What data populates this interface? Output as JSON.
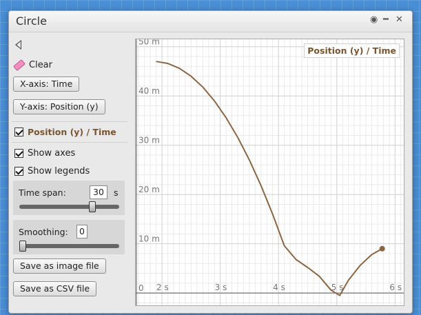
{
  "window": {
    "title": "Circle",
    "controls": [
      "◉",
      "━",
      "✕"
    ]
  },
  "sidebar": {
    "clear_label": "Clear",
    "x_axis_button": "X-axis: Time",
    "y_axis_button": "Y-axis: Position (y)",
    "series_label": "Position (y) / Time",
    "series_checked": true,
    "show_axes_label": "Show axes",
    "show_axes_checked": true,
    "show_legends_label": "Show legends",
    "show_legends_checked": true,
    "time_span_label": "Time span:",
    "time_span_value": "30",
    "time_span_unit": "s",
    "time_span_slider_fraction": 0.75,
    "smoothing_label": "Smoothing:",
    "smoothing_value": "0",
    "smoothing_slider_fraction": 0.0,
    "save_image_button": "Save as image file",
    "save_csv_button": "Save as CSV file"
  },
  "chart_data": {
    "type": "line",
    "legend": "Position (y) / Time",
    "legend_position": "top-right",
    "color": "#8b6542",
    "grid": true,
    "xlim": [
      1.55,
      6.15
    ],
    "ylim": [
      -2.5,
      51.5
    ],
    "x_ticks": [
      {
        "value": 2,
        "label": "2 s"
      },
      {
        "value": 3,
        "label": "3 s"
      },
      {
        "value": 4,
        "label": "4 s"
      },
      {
        "value": 5,
        "label": "5 s"
      },
      {
        "value": 6,
        "label": "6 s"
      }
    ],
    "y_ticks": [
      {
        "value": 0,
        "label": "0"
      },
      {
        "value": 10,
        "label": "10 m"
      },
      {
        "value": 20,
        "label": "20 m"
      },
      {
        "value": 30,
        "label": "30 m"
      },
      {
        "value": 40,
        "label": "40 m"
      },
      {
        "value": 50,
        "label": "50 m"
      }
    ],
    "series": [
      {
        "x": [
          1.9,
          2.1,
          2.3,
          2.5,
          2.7,
          2.9,
          3.1,
          3.3,
          3.5,
          3.7,
          3.9,
          4.1,
          4.3,
          4.5,
          4.7,
          4.9,
          5.05,
          5.2,
          5.4,
          5.6,
          5.78
        ],
        "y": [
          47.0,
          46.6,
          45.6,
          44.0,
          41.8,
          39.0,
          35.6,
          31.6,
          27.0,
          21.8,
          16.0,
          9.6,
          6.8,
          5.2,
          3.4,
          0.6,
          -0.5,
          2.6,
          5.6,
          7.8,
          9.0
        ],
        "end_marker": true
      }
    ]
  }
}
